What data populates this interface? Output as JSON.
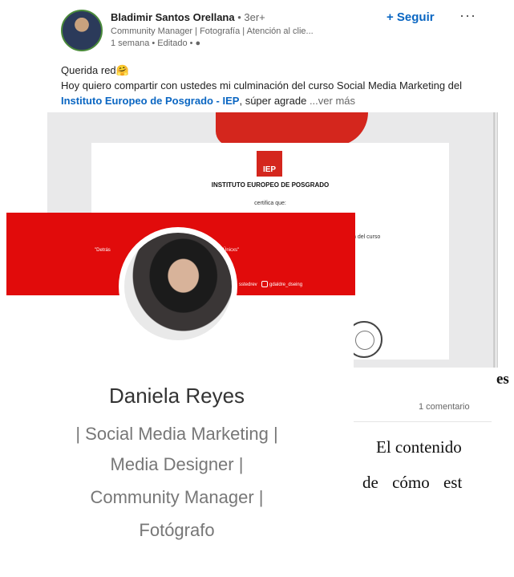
{
  "post": {
    "author": "Bladimir Santos Orellana",
    "degree": " • 3er+",
    "subtitle": "Community Manager | Fotografía | Atención al clie...",
    "time": "1 semana • Editado • ",
    "follow_label": "+ Seguir",
    "more_label": "···",
    "greeting": "Querida red",
    "body_before": "Hoy quiero compartir con ustedes mi culminación del curso Social Media Marketing del ",
    "body_link": "Instituto Europeo de Posgrado - IEP",
    "body_after": ", súper agrade",
    "see_more": "...ver más",
    "comments": "1 comentario"
  },
  "certificate": {
    "logo_text": "IEP",
    "institution": "INSTITUTO EUROPEO DE POSGRADO",
    "certifica": "certifica que:",
    "curso_fragment": "n del curso"
  },
  "banner": {
    "quote_left": "\"Detrás",
    "quote_right": "Únicxs\"",
    "handle_left": "sstedrev",
    "handle_right": "gdaldre_dseing"
  },
  "profile": {
    "name": "Daniela Reyes",
    "lines": [
      "| Social Media Marketing |",
      "Media Designer |",
      "Community Manager |",
      "Fotógrafo"
    ]
  },
  "document": {
    "fragment_es": "es",
    "line1": "El contenido",
    "line2": "de cómo est"
  },
  "colors": {
    "brand_red": "#d4261d",
    "link_blue": "#0a66c2"
  }
}
